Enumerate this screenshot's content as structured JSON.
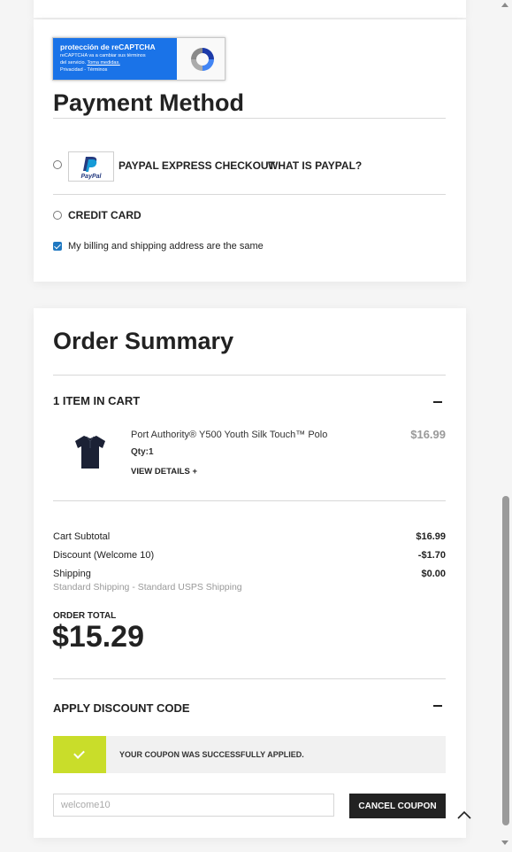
{
  "recaptcha": {
    "title": "protección de reCAPTCHA",
    "line1": "reCAPTCHA va a cambiar sus términos",
    "line2_prefix": "del servicio. ",
    "line2_link": "Toma medidas.",
    "privacy": "Privacidad",
    "separator": " - ",
    "terms": "Términos"
  },
  "payment": {
    "title": "Payment Method",
    "paypal_logo_text": "PayPal",
    "paypal_label": "PAYPAL EXPRESS CHECKOUT",
    "paypal_link": "WHAT IS PAYPAL?",
    "credit_card_label": "CREDIT CARD",
    "same_address_label": "My billing and shipping address are the same",
    "same_address_checked": true
  },
  "order": {
    "title": "Order Summary",
    "items_header": "1 ITEM IN CART",
    "item": {
      "name": "Port Authority® Y500 Youth Silk Touch™ Polo",
      "price": "$16.99",
      "qty": "Qty:1",
      "view_details": "VIEW DETAILS"
    },
    "totals": {
      "subtotal_label": "Cart Subtotal",
      "subtotal_value": "$16.99",
      "discount_label": "Discount (Welcome 10)",
      "discount_value": "-$1.70",
      "shipping_label": "Shipping",
      "shipping_value": "$0.00",
      "shipping_method": "Standard Shipping - Standard USPS Shipping",
      "order_total_label": "ORDER TOTAL",
      "order_total_value": "$15.29"
    },
    "discount": {
      "header": "APPLY DISCOUNT CODE",
      "success_message": "YOUR COUPON WAS SUCCESSFULLY APPLIED.",
      "code_value": "welcome10",
      "cancel_label": "CANCEL COUPON"
    }
  },
  "colors": {
    "accent_success": "#c9dd2a",
    "checkbox": "#1f78c1",
    "recaptcha_blue": "#1a73e8",
    "button_dark": "#222222"
  }
}
